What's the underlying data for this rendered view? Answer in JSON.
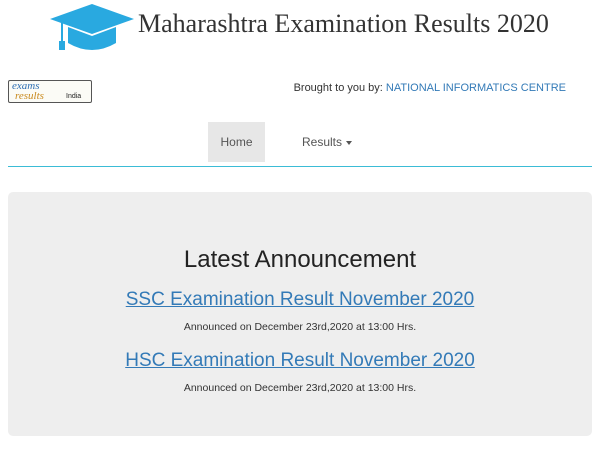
{
  "header": {
    "title": "Maharashtra Examination Results 2020",
    "logo_icon": "graduation-cap-icon",
    "cap_color": "#29a9e0"
  },
  "brand": {
    "line1": "exams",
    "line2": "results",
    "line3": "India"
  },
  "credit": {
    "prefix": "Brought to you by:",
    "org": "NATIONAL INFORMATICS CENTRE"
  },
  "nav": {
    "items": [
      {
        "label": "Home",
        "active": true
      },
      {
        "label": "Results",
        "dropdown": true
      }
    ]
  },
  "announcement": {
    "title": "Latest Announcement",
    "items": [
      {
        "link": "SSC Examination Result November 2020",
        "date": "Announced on December 23rd,2020 at 13:00 Hrs."
      },
      {
        "link": "HSC Examination Result November 2020",
        "date": "Announced on December 23rd,2020 at 13:00 Hrs."
      }
    ]
  },
  "colors": {
    "link": "#337ab7",
    "nav_border": "#3bbcd6",
    "panel_bg": "#eeeeee"
  }
}
